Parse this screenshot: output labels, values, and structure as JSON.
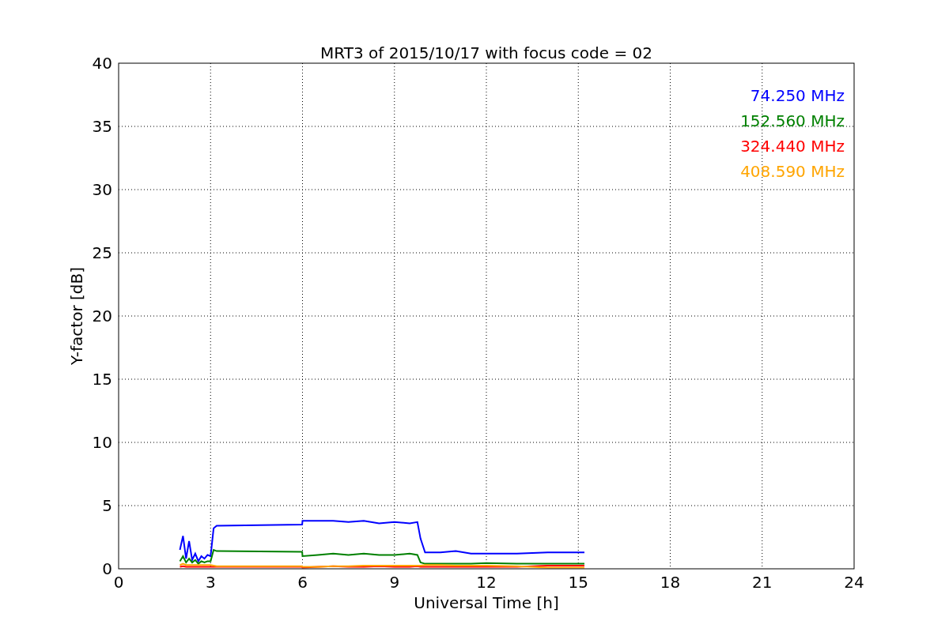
{
  "chart": {
    "chart_data": {
      "type": "line",
      "title": "MRT3 of 2015/10/17 with focus code = 02",
      "xlabel": "Universal Time [h]",
      "ylabel": "Y-factor [dB]",
      "x": [
        2.0,
        2.1,
        2.2,
        2.3,
        2.4,
        2.5,
        2.6,
        2.7,
        2.8,
        2.9,
        3.0,
        3.1,
        3.2,
        5.99,
        6.0,
        6.5,
        7.0,
        7.5,
        8.0,
        8.5,
        9.0,
        9.5,
        9.75,
        9.85,
        10.0,
        10.5,
        11.0,
        11.5,
        12.0,
        13.0,
        14.0,
        15.0,
        15.2
      ],
      "series": [
        {
          "name": "74.250 MHz",
          "color": "#0000ff",
          "values": [
            1.5,
            2.6,
            0.8,
            2.2,
            0.7,
            1.2,
            0.6,
            1.0,
            0.8,
            1.1,
            1.0,
            3.2,
            3.4,
            3.5,
            3.8,
            3.8,
            3.8,
            3.7,
            3.8,
            3.6,
            3.7,
            3.6,
            3.7,
            2.4,
            1.3,
            1.3,
            1.4,
            1.2,
            1.2,
            1.2,
            1.3,
            1.3,
            1.3
          ]
        },
        {
          "name": "152.560 MHz",
          "color": "#008000",
          "values": [
            0.6,
            1.0,
            0.5,
            0.8,
            0.5,
            0.7,
            0.4,
            0.6,
            0.5,
            0.6,
            0.6,
            1.5,
            1.4,
            1.35,
            1.0,
            1.1,
            1.2,
            1.1,
            1.2,
            1.1,
            1.1,
            1.2,
            1.1,
            0.5,
            0.4,
            0.4,
            0.4,
            0.4,
            0.45,
            0.4,
            0.4,
            0.4,
            0.4
          ]
        },
        {
          "name": "324.440 MHz",
          "color": "#ff0000",
          "values": [
            0.15,
            0.2,
            0.15,
            0.15,
            0.15,
            0.15,
            0.15,
            0.15,
            0.15,
            0.15,
            0.15,
            0.15,
            0.15,
            0.15,
            0.1,
            0.15,
            0.2,
            0.15,
            0.15,
            0.2,
            0.15,
            0.15,
            0.2,
            0.15,
            0.15,
            0.15,
            0.15,
            0.15,
            0.15,
            0.15,
            0.25,
            0.25,
            0.25
          ]
        },
        {
          "name": "408.590 MHz",
          "color": "#ffa500",
          "values": [
            0.3,
            0.4,
            0.3,
            0.3,
            0.3,
            0.3,
            0.3,
            0.3,
            0.3,
            0.3,
            0.3,
            0.25,
            0.2,
            0.2,
            0.15,
            0.15,
            0.2,
            0.2,
            0.25,
            0.25,
            0.25,
            0.25,
            0.25,
            0.25,
            0.3,
            0.3,
            0.25,
            0.25,
            0.25,
            0.2,
            0.1,
            0.1,
            0.1
          ]
        }
      ],
      "grid": true,
      "xlim": [
        0,
        24
      ],
      "ylim": [
        0,
        40
      ],
      "xticks": [
        0,
        3,
        6,
        9,
        12,
        15,
        18,
        21,
        24
      ],
      "yticks": [
        0,
        5,
        10,
        15,
        20,
        25,
        30,
        35,
        40
      ]
    }
  }
}
